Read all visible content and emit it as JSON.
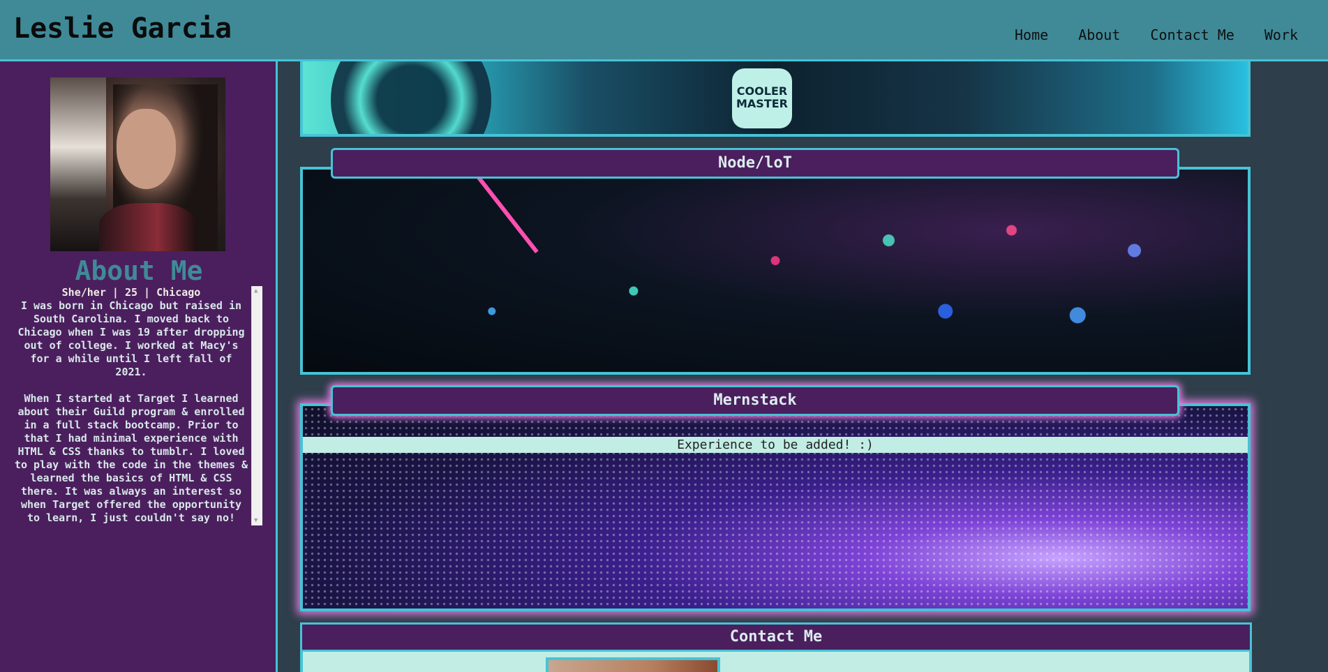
{
  "header": {
    "title": "Leslie Garcia",
    "nav": [
      "Home",
      "About",
      "Contact Me",
      "Work"
    ]
  },
  "sidebar": {
    "heading": "About Me",
    "subheading": "She/her | 25 | Chicago",
    "bio": "I was born in Chicago but raised in South Carolina. I moved back to Chicago when I was 19 after dropping out of college. I worked at Macy's for a while until I left fall of 2021.\n\nWhen I started at Target I learned about their Guild program & enrolled in a full stack bootcamp. Prior to that I had minimal experience with HTML & CSS thanks to tumblr. I loved to play with the code in the themes & learned the basics of HTML & CSS there. It was always an interest so when Target offered the opportunity to learn, I just couldn't say no!"
  },
  "work": {
    "logo_text": "COOLER MASTER",
    "cards": [
      {
        "label": "Node/loT"
      },
      {
        "label": "Mernstack",
        "note": "Experience to be added! :)"
      }
    ]
  },
  "contact": {
    "heading": "Contact Me"
  },
  "colors": {
    "header_bg": "#408a98",
    "sidebar_bg": "#4b1f5d",
    "accent": "#46c3d6",
    "page_bg": "#2e3e4a",
    "light_panel": "#c2ede4"
  }
}
